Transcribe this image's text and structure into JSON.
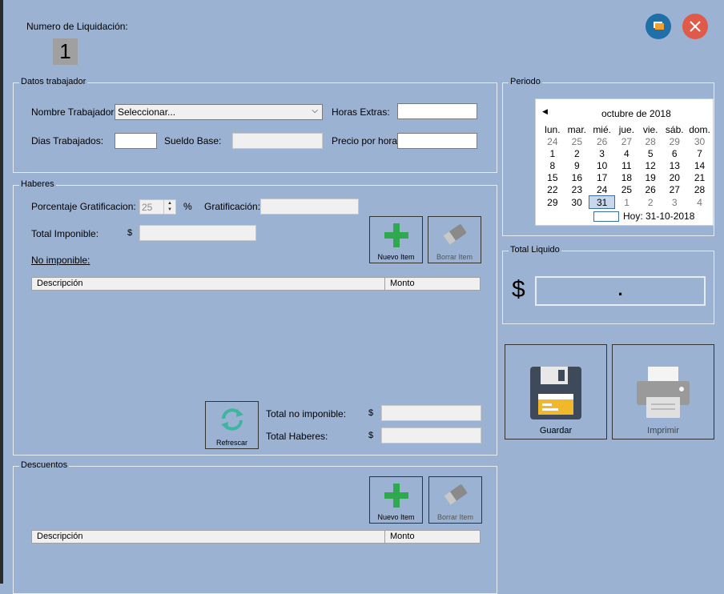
{
  "header": {
    "liquidacion_label": "Numero de Liquidación:",
    "liquidacion_number": "1"
  },
  "datos_trabajador": {
    "title": "Datos trabajador",
    "nombre_label": "Nombre Trabajador:",
    "nombre_value": "Seleccionar...",
    "horas_extras_label": "Horas Extras:",
    "dias_label": "Dias Trabajados:",
    "sueldo_label": "Sueldo Base:",
    "precio_label": "Precio por hora:"
  },
  "periodo": {
    "title": "Periodo",
    "month": "octubre de 2018",
    "weekdays": [
      "lun.",
      "mar.",
      "mié.",
      "jue.",
      "vie.",
      "sáb.",
      "dom."
    ],
    "weeks": [
      [
        "24",
        "25",
        "26",
        "27",
        "28",
        "29",
        "30"
      ],
      [
        "1",
        "2",
        "3",
        "4",
        "5",
        "6",
        "7"
      ],
      [
        "8",
        "9",
        "10",
        "11",
        "12",
        "13",
        "14"
      ],
      [
        "15",
        "16",
        "17",
        "18",
        "19",
        "20",
        "21"
      ],
      [
        "22",
        "23",
        "24",
        "25",
        "26",
        "27",
        "28"
      ],
      [
        "29",
        "30",
        "31",
        "1",
        "2",
        "3",
        "4"
      ]
    ],
    "today_label": "Hoy: 31-10-2018"
  },
  "haberes": {
    "title": "Haberes",
    "porcentaje_label": "Porcentaje Gratificacion:",
    "porcentaje_value": "25",
    "percent_sign": "%",
    "gratificacion_label": "Gratificación:",
    "total_imponible_label": "Total Imponible:",
    "currency": "$",
    "no_imponible_label": "No imponible:",
    "col_descripcion": "Descripción",
    "col_monto": "Monto",
    "nuevo_label": "Nuevo Item",
    "borrar_label": "Borrar Item",
    "refrescar_label": "Refrescar",
    "total_no_imponible_label": "Total no imponible:",
    "total_haberes_label": "Total Haberes:"
  },
  "total_liquido": {
    "title": "Total Liquido",
    "currency": "$",
    "value": "."
  },
  "actions": {
    "guardar_label": "Guardar",
    "imprimir_label": "Imprimir"
  },
  "descuentos": {
    "title": "Descuentos",
    "nuevo_label": "Nuevo Item",
    "borrar_label": "Borrar Item",
    "col_descripcion": "Descripción",
    "col_monto": "Monto"
  },
  "colors": {
    "background": "#9bb2d2",
    "minimize": "#1f6fa8",
    "close": "#e05a4a",
    "add": "#2fa84f"
  }
}
